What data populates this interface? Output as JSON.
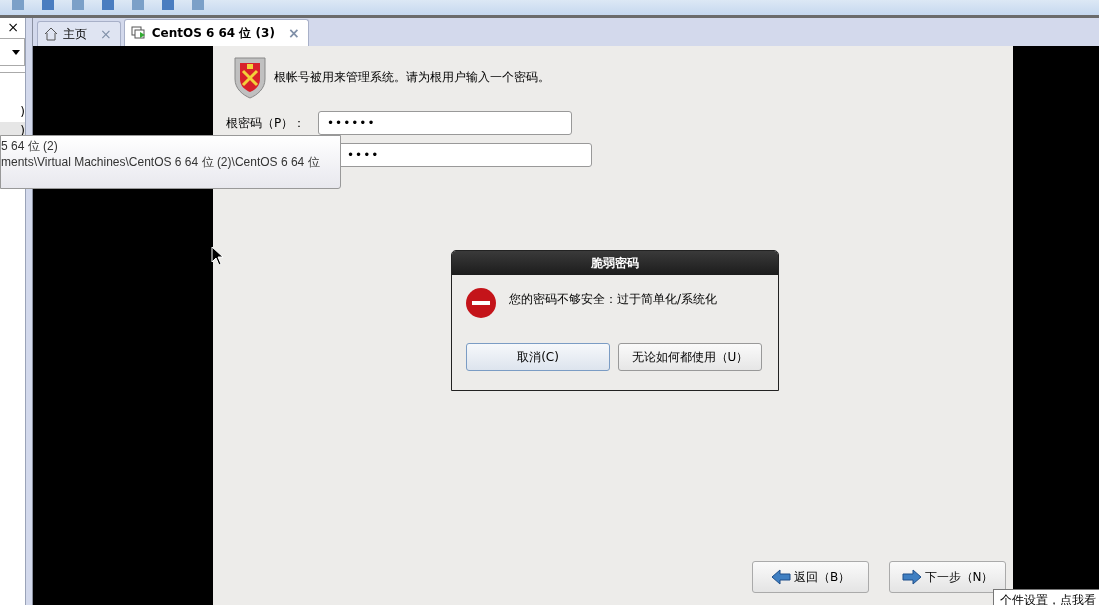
{
  "sidebar": {
    "close": "×",
    "items": [
      {
        "label": ")",
        "selected": false
      },
      {
        "label": ")",
        "selected": true
      }
    ]
  },
  "tabs": [
    {
      "label": "主页",
      "kind": "home",
      "selected": false,
      "close": "×"
    },
    {
      "label": "CentOS 6 64 位 (3)",
      "kind": "vm",
      "selected": true,
      "close": "×"
    }
  ],
  "installer": {
    "intro": "根帐号被用来管理系统。请为根用户输入一个密码。",
    "fields": [
      {
        "label": "根密码（P）：",
        "value": "••••••"
      },
      {
        "value": "••••"
      }
    ],
    "back_button": "返回（B）",
    "next_button": "下一步（N）"
  },
  "tooltip": {
    "lines": [
      "5 64 位 (2)",
      "ments\\Virtual Machines\\CentOS 6 64 位 (2)\\CentOS 6 64 位"
    ]
  },
  "dialog": {
    "title": "脆弱密码",
    "message": "您的密码不够安全：过于简单化/系统化",
    "buttons": [
      {
        "label": "取消(C)",
        "selected": true
      },
      {
        "label": "无论如何都使用（U）",
        "selected": false
      }
    ]
  },
  "corner_tip": "个件设置，点我看"
}
